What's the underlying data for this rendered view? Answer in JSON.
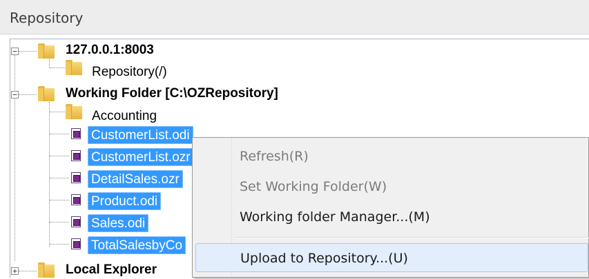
{
  "panel": {
    "title": "Repository"
  },
  "tree": {
    "server": {
      "label": "127.0.0.1:8003",
      "expander": "−"
    },
    "repository": {
      "label": "Repository(/)"
    },
    "working_folder": {
      "label": "Working Folder [C:\\OZRepository]",
      "expander": "−"
    },
    "accounting": {
      "label": "Accounting"
    },
    "files": [
      {
        "label": "CustomerList.odi"
      },
      {
        "label": "CustomerList.ozr"
      },
      {
        "label": "DetailSales.ozr"
      },
      {
        "label": "Product.odi"
      },
      {
        "label": "Sales.odi"
      },
      {
        "label": "TotalSalesbyCo"
      }
    ],
    "local_explorer": {
      "label": "Local Explorer",
      "expander": "+"
    }
  },
  "context_menu": {
    "items": [
      {
        "label": "Refresh(R)",
        "state": "disabled"
      },
      {
        "label": "Set Working Folder(W)",
        "state": "disabled"
      },
      {
        "label": "Working folder Manager...(M)",
        "state": "enabled"
      },
      {
        "label": "Upload to Repository...(U)",
        "state": "hover"
      }
    ]
  },
  "colors": {
    "selection": "#3399ff",
    "folder": "#e7b43a",
    "file_icon": "#7a2c8e",
    "menu_hover": "#e2eefc"
  },
  "icons": [
    "folder-icon",
    "odi-file-icon",
    "ozr-file-icon",
    "expander-minus-icon",
    "expander-plus-icon"
  ]
}
